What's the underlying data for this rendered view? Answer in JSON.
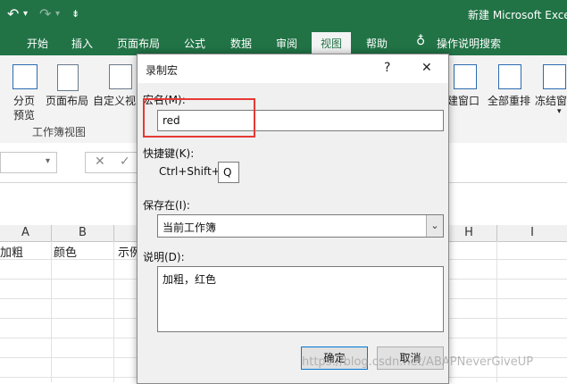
{
  "window": {
    "title": "新建 Microsoft Exce"
  },
  "ribbon_tabs": [
    "开始",
    "插入",
    "页面布局",
    "公式",
    "数据",
    "审阅",
    "视图",
    "帮助",
    "操作说明搜索"
  ],
  "ribbon": {
    "left_buttons": [
      {
        "label": "分页",
        "label2": "预览"
      },
      {
        "label": "页面布局"
      },
      {
        "label": "自定义视"
      }
    ],
    "group_label": "工作簿视图",
    "right_buttons": [
      "建窗口",
      "全部重排",
      "冻结窗"
    ]
  },
  "grid": {
    "columns": [
      "A",
      "B",
      "H",
      "I"
    ],
    "row1": [
      "加粗",
      "颜色",
      "示例"
    ]
  },
  "dialog": {
    "title": "录制宏",
    "help_glyph": "?",
    "close_glyph": "✕",
    "macro_name_label": "宏名(M):",
    "macro_name_value": "red",
    "shortcut_label": "快捷键(K):",
    "shortcut_prefix": "Ctrl+Shift+",
    "shortcut_key": "Q",
    "store_label": "保存在(I):",
    "store_value": "当前工作簿",
    "desc_label": "说明(D):",
    "desc_value": "加粗，红色",
    "ok_label": "确定",
    "cancel_label": "取消"
  },
  "watermark": "https://blog.csdn.net/ABAPNeverGiveUP",
  "colors": {
    "ribbon_green": "#217346",
    "highlight_red": "#e53935"
  }
}
